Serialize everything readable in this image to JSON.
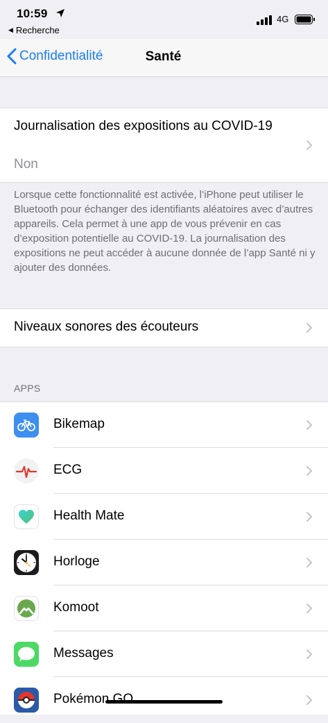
{
  "status_bar": {
    "time": "10:59",
    "back_app": "Recherche",
    "network": "4G"
  },
  "nav": {
    "back_label": "Confidentialité",
    "title": "Santé"
  },
  "covid": {
    "title": "Journalisation des expositions au COVID-19",
    "value": "Non",
    "footnote": "Lorsque cette fonctionnalité est activée, l’iPhone peut utiliser le Bluetooth pour échanger des identifiants aléatoires avec d’autres appareils. Cela permet à une app de vous prévenir en cas d’exposition potentielle au COVID-19. La journalisation des expositions ne peut accéder à aucune donnée de l’app Santé ni y ajouter des données."
  },
  "niveaux": {
    "label": "Niveaux sonores des écouteurs"
  },
  "apps_section": {
    "header": "APPS",
    "items": [
      {
        "label": "Bikemap",
        "icon": "bikemap-icon"
      },
      {
        "label": "ECG",
        "icon": "ecg-icon"
      },
      {
        "label": "Health Mate",
        "icon": "health-mate-icon"
      },
      {
        "label": "Horloge",
        "icon": "clock-icon"
      },
      {
        "label": "Komoot",
        "icon": "komoot-icon"
      },
      {
        "label": "Messages",
        "icon": "messages-icon"
      },
      {
        "label": "Pokémon GO",
        "icon": "pokemon-go-icon"
      }
    ]
  },
  "colors": {
    "accent": "#1a7cf5",
    "background": "#efeff4"
  }
}
